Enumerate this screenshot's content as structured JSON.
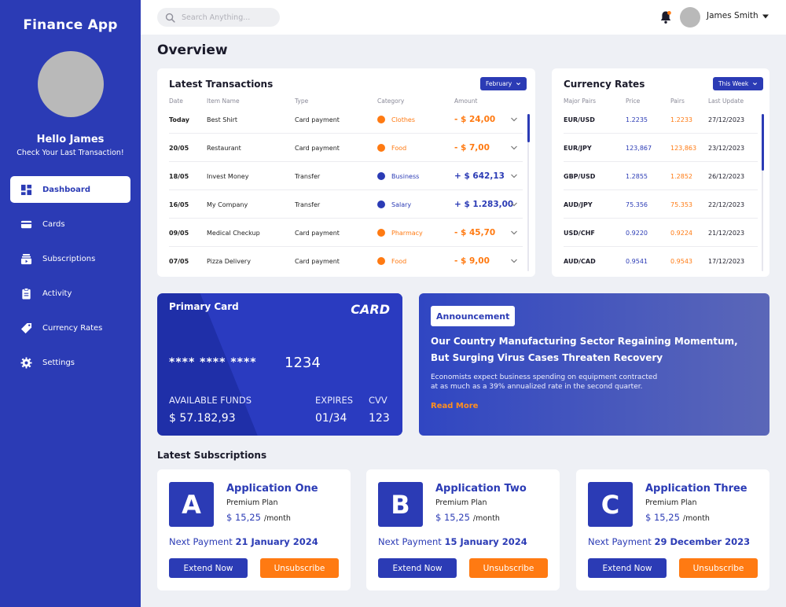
{
  "colors": {
    "primary": "#2b3bb5",
    "accent": "#ff7a12",
    "negative": "#ff7a12",
    "positive": "#2b3bb5"
  },
  "sidebar": {
    "app_title": "Finance App",
    "greeting": "Hello James",
    "greeting_sub": "Check Your Last Transaction!",
    "items": [
      {
        "label": "Dashboard",
        "icon": "dashboard-icon",
        "active": true
      },
      {
        "label": "Cards",
        "icon": "credit-card-icon"
      },
      {
        "label": "Subscriptions",
        "icon": "subscriptions-icon"
      },
      {
        "label": "Activity",
        "icon": "clipboard-icon"
      },
      {
        "label": "Currency Rates",
        "icon": "currency-tag-icon"
      },
      {
        "label": "Settings",
        "icon": "gear-icon"
      }
    ]
  },
  "topbar": {
    "search_placeholder": "Search Anything...",
    "user_name": "James Smith"
  },
  "page_title": "Overview",
  "transactions": {
    "title": "Latest Transactions",
    "filter": "February",
    "columns": [
      "Date",
      "Item Name",
      "Type",
      "Category",
      "Amount"
    ],
    "rows": [
      {
        "date": "Today",
        "item": "Best Shirt",
        "type": "Card payment",
        "category": "Clothes",
        "cat_color": "#ff7a12",
        "amount": "- $ 24,00",
        "amount_color": "#ff7a12"
      },
      {
        "date": "20/05",
        "item": "Restaurant",
        "type": "Card payment",
        "category": "Food",
        "cat_color": "#ff7a12",
        "amount": "- $ 7,00",
        "amount_color": "#ff7a12"
      },
      {
        "date": "18/05",
        "item": "Invest Money",
        "type": "Transfer",
        "category": "Business",
        "cat_color": "#2b3bb5",
        "amount": "+ $ 642,13",
        "amount_color": "#2b3bb5"
      },
      {
        "date": "16/05",
        "item": "My Company",
        "type": "Transfer",
        "category": "Salary",
        "cat_color": "#2b3bb5",
        "amount": "+ $ 1.283,00",
        "amount_color": "#2b3bb5"
      },
      {
        "date": "09/05",
        "item": "Medical Checkup",
        "type": "Card payment",
        "category": "Pharmacy",
        "cat_color": "#ff7a12",
        "amount": "- $ 45,70",
        "amount_color": "#ff7a12"
      },
      {
        "date": "07/05",
        "item": "Pizza Delivery",
        "type": "Card payment",
        "category": "Food",
        "cat_color": "#ff7a12",
        "amount": "- $ 9,00",
        "amount_color": "#ff7a12"
      }
    ]
  },
  "currency": {
    "title": "Currency Rates",
    "filter": "This Week",
    "columns": [
      "Major Pairs",
      "Price",
      "Pairs",
      "Last Update"
    ],
    "rows": [
      {
        "pair": "EUR/USD",
        "price": "1.2235",
        "pairs": "1.2233",
        "updated": "27/12/2023"
      },
      {
        "pair": "EUR/JPY",
        "price": "123,867",
        "pairs": "123,863",
        "updated": "23/12/2023"
      },
      {
        "pair": "GBP/USD",
        "price": "1.2855",
        "pairs": "1.2852",
        "updated": "26/12/2023"
      },
      {
        "pair": "AUD/JPY",
        "price": "75.356",
        "pairs": "75.353",
        "updated": "22/12/2023"
      },
      {
        "pair": "USD/CHF",
        "price": "0.9220",
        "pairs": "0.9224",
        "updated": "21/12/2023"
      },
      {
        "pair": "AUD/CAD",
        "price": "0.9541",
        "pairs": "0.9543",
        "updated": "17/12/2023"
      }
    ]
  },
  "primary_card": {
    "label": "Primary Card",
    "brand": "CARD",
    "masked": "**** **** ****",
    "last4": "1234",
    "funds_label": "AVAILABLE FUNDS",
    "funds": "$ 57.182,93",
    "expires_label": "EXPIRES",
    "expires": "01/34",
    "cvv_label": "CVV",
    "cvv": "123"
  },
  "announcement": {
    "badge": "Announcement",
    "headline_1": "Our Country Manufacturing Sector Regaining Momentum,",
    "headline_2": "But Surging Virus Cases Threaten Recovery",
    "body_1": "Economists expect business spending on equipment contracted",
    "body_2": "at as much as a 39% annualized rate in the second quarter.",
    "link": "Read More"
  },
  "subscriptions": {
    "title": "Latest Subscriptions",
    "next_label": "Next Payment",
    "per": "/month",
    "extend_label": "Extend Now",
    "unsub_label": "Unsubscribe",
    "items": [
      {
        "letter": "A",
        "name": "Application One",
        "plan": "Premium Plan",
        "price": "$ 15,25",
        "next_date": "21 January 2024"
      },
      {
        "letter": "B",
        "name": "Application Two",
        "plan": "Premium Plan",
        "price": "$ 15,25",
        "next_date": "15 January 2024"
      },
      {
        "letter": "C",
        "name": "Application Three",
        "plan": "Premium Plan",
        "price": "$ 15,25",
        "next_date": "29 December 2023"
      }
    ]
  }
}
